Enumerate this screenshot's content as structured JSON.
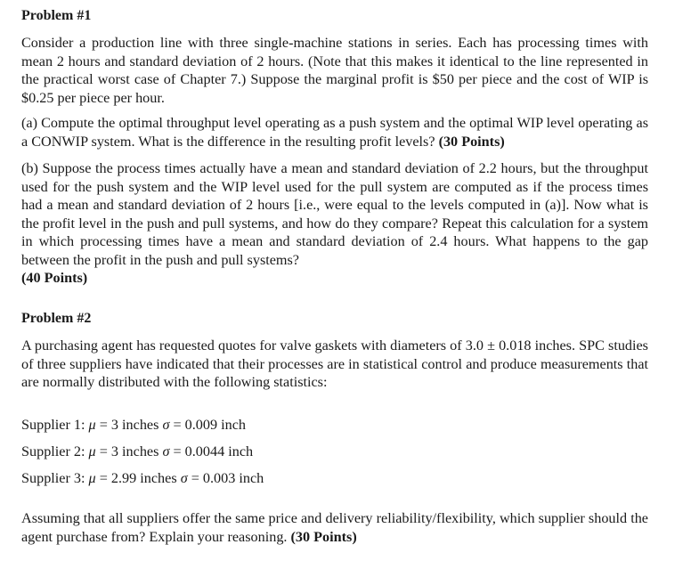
{
  "problem1": {
    "heading": "Problem #1",
    "intro": "Consider a production line with three single-machine stations in series. Each has processing times with mean 2 hours and standard deviation of 2 hours. (Note that this makes it identical to the line represented in the practical worst case of Chapter 7.) Suppose the marginal profit is $50 per piece and the cost of WIP is $0.25 per piece per hour.",
    "part_a": {
      "text": "(a) Compute the optimal throughput level operating as a push system and the optimal WIP level operating as a CONWIP system. What is the difference in the resulting profit levels? ",
      "points": "(30 Points)"
    },
    "part_b": {
      "text": "(b) Suppose the process times actually have a mean and standard deviation of 2.2 hours, but the throughput used for the push system and the WIP level used for the pull system are computed as if the process times had a mean and standard deviation of 2 hours [i.e., were equal to the levels computed in (a)]. Now what is the profit level in the push and pull systems, and how do they compare? Repeat this calculation for a system in which processing times have a mean and standard deviation of 2.4 hours. What happens to the gap between the profit in the push and pull systems?",
      "points": "(40 Points)"
    }
  },
  "problem2": {
    "heading": "Problem #2",
    "intro": "A purchasing agent has requested quotes for valve gaskets with diameters of 3.0 ± 0.018 inches. SPC studies of three suppliers have indicated that their processes are in statistical control and produce measurements that are normally distributed with the following statistics:",
    "suppliers": [
      {
        "label": "Supplier 1:",
        "mu_symbol": "μ",
        "mu": "= 3 inches",
        "sigma_symbol": "σ",
        "sigma": "= 0.009 inch"
      },
      {
        "label": "Supplier 2:",
        "mu_symbol": "μ",
        "mu": "= 3 inches",
        "sigma_symbol": "σ",
        "sigma": "= 0.0044 inch"
      },
      {
        "label": "Supplier 3:",
        "mu_symbol": "μ",
        "mu": "= 2.99 inches",
        "sigma_symbol": "σ",
        "sigma": "= 0.003 inch"
      }
    ],
    "question": {
      "text": "Assuming that all suppliers offer the same price and delivery reliability/flexibility, which supplier should the agent purchase from? Explain your reasoning. ",
      "points": "(30 Points)"
    }
  }
}
